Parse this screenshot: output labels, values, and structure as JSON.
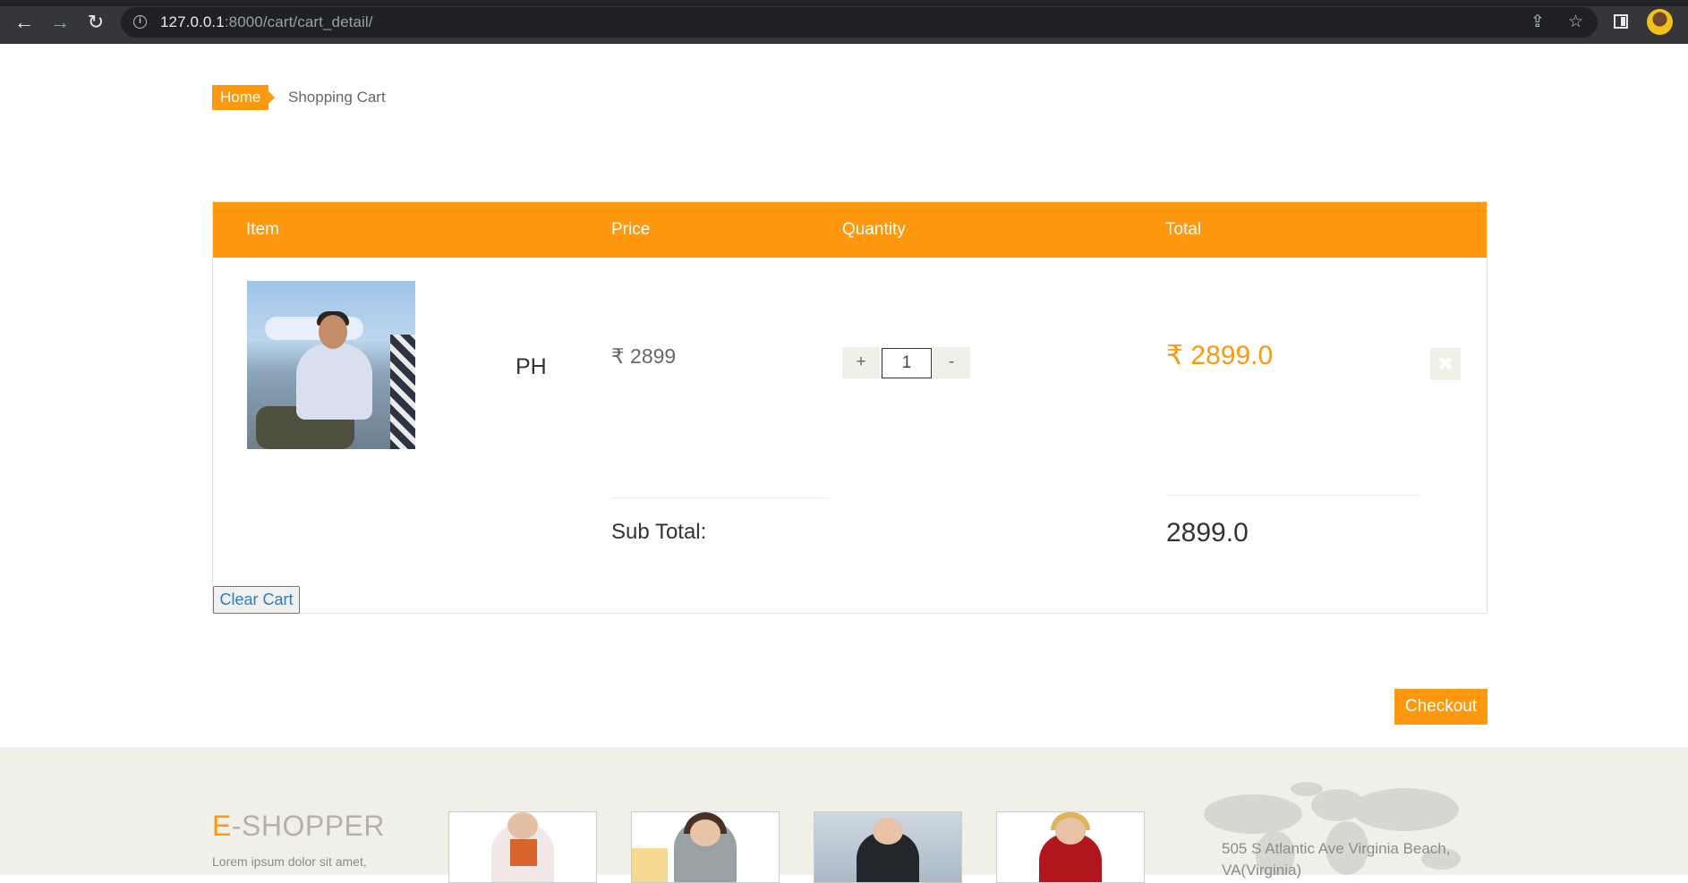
{
  "browser": {
    "url_host": "127.0.0.1",
    "url_rest": ":8000/cart/cart_detail/"
  },
  "breadcrumb": {
    "home": "Home",
    "current": "Shopping Cart"
  },
  "cart": {
    "headers": {
      "item": "Item",
      "price": "Price",
      "quantity": "Quantity",
      "total": "Total"
    },
    "items": [
      {
        "name": "PH",
        "price": "₹ 2899",
        "quantity": "1",
        "total": "₹ 2899.0"
      }
    ],
    "qty_plus": "+",
    "qty_minus": "-",
    "delete_glyph": "✖",
    "subtotal_label": "Sub Total:",
    "subtotal_value": "2899.0",
    "clear_label": "Clear Cart",
    "checkout_label": "Checkout"
  },
  "footer": {
    "brand_e": "E",
    "brand_rest": "-SHOPPER",
    "lorem": "Lorem ipsum dolor sit amet,",
    "address": "505 S Atlantic Ave Virginia Beach, VA(Virginia)"
  },
  "colors": {
    "accent": "#fe980f",
    "muted_text": "#696763",
    "footer_bg": "#f0f0e9"
  },
  "icons": [
    "back-arrow-icon",
    "forward-arrow-icon",
    "reload-icon",
    "site-info-icon",
    "share-icon",
    "star-icon",
    "side-panel-icon",
    "profile-avatar",
    "delete-icon"
  ]
}
